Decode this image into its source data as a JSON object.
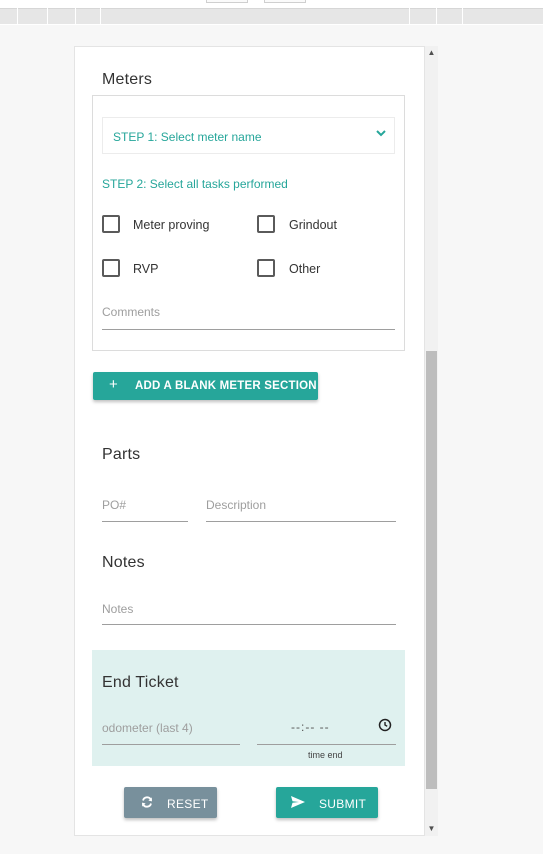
{
  "meters": {
    "title": "Meters",
    "select_label": "STEP 1: Select meter name",
    "step2_label": "STEP 2: Select all tasks performed",
    "tasks": [
      {
        "label": "Meter proving",
        "checked": false
      },
      {
        "label": "Grindout",
        "checked": false
      },
      {
        "label": "RVP",
        "checked": false
      },
      {
        "label": "Other",
        "checked": false
      }
    ],
    "comments_placeholder": "Comments",
    "add_button_label": "ADD A BLANK METER SECTION"
  },
  "parts": {
    "title": "Parts",
    "po_placeholder": "PO#",
    "description_placeholder": "Description"
  },
  "notes": {
    "title": "Notes",
    "notes_placeholder": "Notes"
  },
  "end_ticket": {
    "title": "End Ticket",
    "odometer_placeholder": "odometer (last 4)",
    "time_value": "--:-- --",
    "time_hint": "time end"
  },
  "actions": {
    "reset_label": "RESET",
    "submit_label": "SUBMIT"
  },
  "colors": {
    "accent": "#26a69a",
    "reset": "#78909c",
    "end_panel": "#dff1ef"
  }
}
